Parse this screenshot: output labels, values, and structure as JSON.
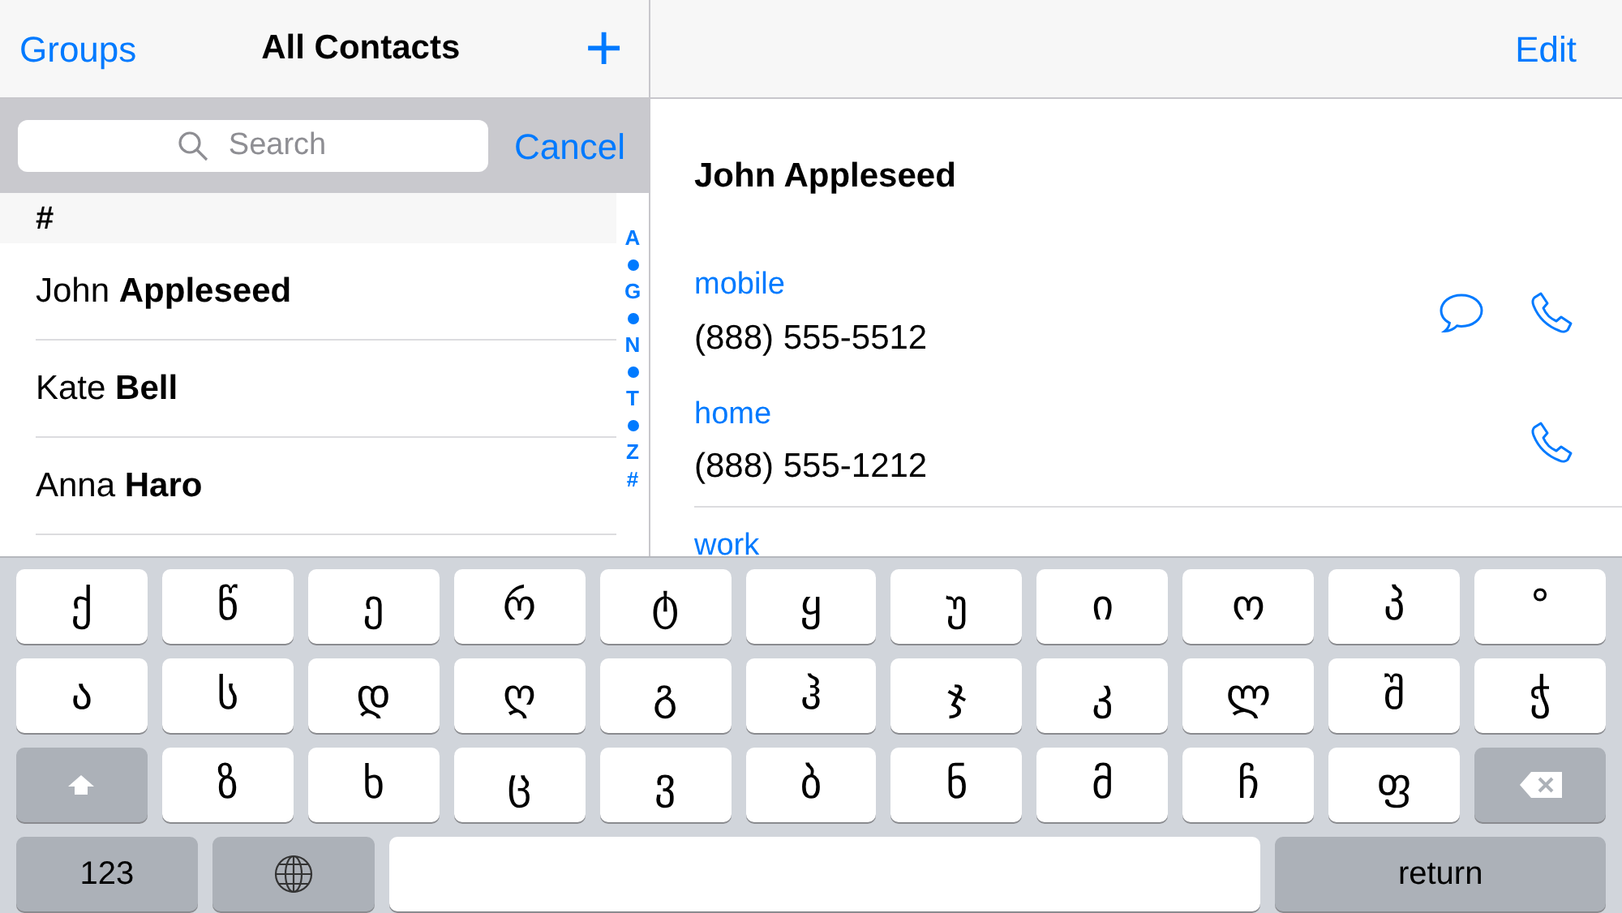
{
  "list_header": {
    "left": "Groups",
    "title": "All Contacts",
    "add": "+"
  },
  "search": {
    "placeholder": "Search",
    "cancel": "Cancel"
  },
  "section": "#",
  "contacts": [
    {
      "first": "John",
      "last": "Appleseed"
    },
    {
      "first": "Kate",
      "last": "Bell"
    },
    {
      "first": "Anna",
      "last": "Haro"
    }
  ],
  "index": [
    {
      "kind": "letter",
      "text": "A"
    },
    {
      "kind": "dot"
    },
    {
      "kind": "letter",
      "text": "G"
    },
    {
      "kind": "dot"
    },
    {
      "kind": "letter",
      "text": "N"
    },
    {
      "kind": "dot"
    },
    {
      "kind": "letter",
      "text": "T"
    },
    {
      "kind": "dot"
    },
    {
      "kind": "letter",
      "text": "Z"
    },
    {
      "kind": "letter",
      "text": "#"
    }
  ],
  "detail": {
    "edit": "Edit",
    "name": "John Appleseed",
    "fields": [
      {
        "label": "mobile",
        "value": "(888) 555-5512",
        "actions": [
          {
            "kind": "message"
          },
          {
            "kind": "call"
          }
        ]
      },
      {
        "label": "home",
        "value": "(888) 555-1212",
        "actions": [
          {
            "kind": "call"
          }
        ]
      },
      {
        "label": "work"
      }
    ]
  },
  "keyboard": {
    "rows": [
      [
        {
          "kind": "char",
          "text": "ქ"
        },
        {
          "kind": "char",
          "text": "წ"
        },
        {
          "kind": "char",
          "text": "ე"
        },
        {
          "kind": "char",
          "text": "რ"
        },
        {
          "kind": "char",
          "text": "ტ"
        },
        {
          "kind": "char",
          "text": "ყ"
        },
        {
          "kind": "char",
          "text": "უ"
        },
        {
          "kind": "char",
          "text": "ი"
        },
        {
          "kind": "char",
          "text": "ო"
        },
        {
          "kind": "char",
          "text": "პ"
        },
        {
          "kind": "char",
          "text": "°"
        }
      ],
      [
        {
          "kind": "char",
          "text": "ა"
        },
        {
          "kind": "char",
          "text": "ს"
        },
        {
          "kind": "char",
          "text": "დ"
        },
        {
          "kind": "char",
          "text": "ღ"
        },
        {
          "kind": "char",
          "text": "გ"
        },
        {
          "kind": "char",
          "text": "ჰ"
        },
        {
          "kind": "char",
          "text": "ჯ"
        },
        {
          "kind": "char",
          "text": "კ"
        },
        {
          "kind": "char",
          "text": "ლ"
        },
        {
          "kind": "char",
          "text": "შ"
        },
        {
          "kind": "char",
          "text": "ჭ"
        }
      ],
      [
        {
          "kind": "shift"
        },
        {
          "kind": "char",
          "text": "ზ"
        },
        {
          "kind": "char",
          "text": "ხ"
        },
        {
          "kind": "char",
          "text": "ც"
        },
        {
          "kind": "char",
          "text": "ვ"
        },
        {
          "kind": "char",
          "text": "ბ"
        },
        {
          "kind": "char",
          "text": "ნ"
        },
        {
          "kind": "char",
          "text": "მ"
        },
        {
          "kind": "char",
          "text": "ჩ"
        },
        {
          "kind": "char",
          "text": "ფ"
        },
        {
          "kind": "delete"
        }
      ],
      [
        {
          "kind": "numbers",
          "text": "123"
        },
        {
          "kind": "globe"
        },
        {
          "kind": "space"
        },
        {
          "kind": "return",
          "text": "return"
        }
      ]
    ]
  }
}
